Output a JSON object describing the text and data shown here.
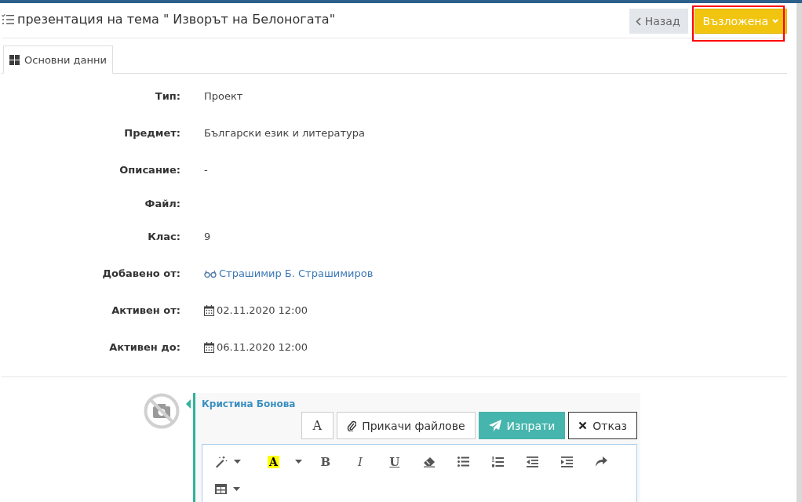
{
  "header": {
    "title": "презентация на тема \" Изворът на Белоногата\"",
    "back_button": "Назад",
    "status_button": "Възложена",
    "status_highlighted": true
  },
  "tabs": [
    {
      "label": "Основни данни",
      "selected": true
    }
  ],
  "details": [
    {
      "label": "Тип:",
      "value": "Проект",
      "kind": "text"
    },
    {
      "label": "Предмет:",
      "value": "Български език и литература",
      "kind": "text"
    },
    {
      "label": "Описание:",
      "value": "-",
      "kind": "text"
    },
    {
      "label": "Файл:",
      "kind": "empty"
    },
    {
      "label": "Клас:",
      "value": "9",
      "kind": "text"
    },
    {
      "label": "Добавено от:",
      "value": "Страшимир Б. Страшимиров",
      "kind": "person"
    },
    {
      "label": "Активен от:",
      "value": "02.11.2020 12:00",
      "kind": "date"
    },
    {
      "label": "Активен до:",
      "value": "06.11.2020 12:00",
      "kind": "date"
    }
  ],
  "comment": {
    "author": "Кристина Бонова",
    "font_button": "A",
    "attach_button": "Прикачи файлове",
    "send_button": "Изпрати",
    "cancel_button": "Отказ",
    "toolbar": [
      {
        "kind": "magic",
        "dropdown": true
      },
      {
        "kind": "highlight",
        "label": "A",
        "dropdown": true
      },
      {
        "kind": "bold",
        "label": "B",
        "dropdown": false
      },
      {
        "kind": "italic",
        "label": "I",
        "dropdown": false
      },
      {
        "kind": "underline",
        "label": "U",
        "dropdown": false
      },
      {
        "kind": "eraser",
        "dropdown": false
      },
      {
        "kind": "bullets",
        "dropdown": false
      },
      {
        "kind": "numbers",
        "dropdown": false
      },
      {
        "kind": "outdent",
        "dropdown": false
      },
      {
        "kind": "indent",
        "dropdown": false
      },
      {
        "kind": "redo",
        "dropdown": false
      },
      {
        "kind": "table",
        "dropdown": true
      }
    ]
  }
}
